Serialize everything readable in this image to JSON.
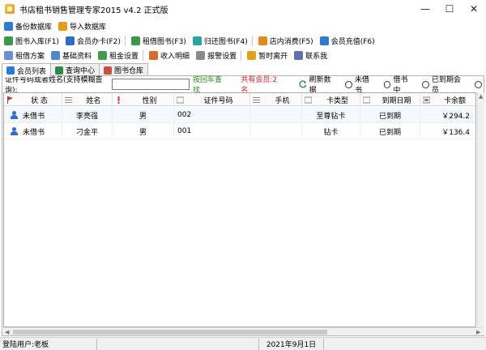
{
  "window": {
    "title": "书店租书销售管理专家2015 v4.2 正式版",
    "controls": {
      "minimize": "—",
      "maximize": "☐",
      "close": "✕"
    }
  },
  "toolbar1": [
    {
      "label": "备份数据库",
      "icon": "database-backup-icon",
      "color": "#2b7bd8"
    },
    {
      "label": "导入数据库",
      "icon": "database-import-icon",
      "color": "#e59b22"
    }
  ],
  "toolbar2": [
    {
      "label": "图书入库(F1)",
      "icon": "book-stock-icon",
      "color": "#3a9a4a"
    },
    {
      "label": "会员办卡(F2)",
      "icon": "member-card-icon",
      "color": "#2b6fc9"
    },
    {
      "label": "租借图书(F3)",
      "icon": "book-lend-icon",
      "color": "#3a9a4a"
    },
    {
      "label": "归还图书(F4)",
      "icon": "book-return-icon",
      "color": "#2aa6a0"
    },
    {
      "label": "店内消费(F5)",
      "icon": "in-store-consume-icon",
      "color": "#e28a1e"
    },
    {
      "label": "会员充值(F6)",
      "icon": "member-recharge-icon",
      "color": "#2b7bd8"
    }
  ],
  "toolbar3": [
    {
      "label": "租借方案",
      "icon": "rental-plan-icon",
      "color": "#6b8fd6"
    },
    {
      "label": "基础资料",
      "icon": "basic-data-icon",
      "color": "#4f86d0"
    },
    {
      "label": "租金设置",
      "icon": "rent-setting-icon",
      "color": "#3d9e52"
    },
    {
      "label": "收入明细",
      "icon": "income-detail-icon",
      "color": "#d56b2c"
    },
    {
      "label": "报警设置",
      "icon": "alarm-setting-icon",
      "color": "#8a8a8a"
    },
    {
      "label": "暂时离开",
      "icon": "lock-icon",
      "color": "#e0a21c"
    },
    {
      "label": "联系我",
      "icon": "contact-icon",
      "color": "#5f6fb0"
    }
  ],
  "tabs": [
    {
      "label": "会员列表",
      "active": true,
      "icon": "member-list-icon",
      "color": "#2b7bd8"
    },
    {
      "label": "查询中心",
      "active": false,
      "icon": "query-center-icon",
      "color": "#2e8a4a"
    },
    {
      "label": "图书仓库",
      "active": false,
      "icon": "book-warehouse-icon",
      "color": "#c74f3b"
    }
  ],
  "search": {
    "label": "证件号码或者姓名(支持模糊查询):",
    "value": "",
    "hint": "按回车查找",
    "member_count": "共有会员:2名",
    "refresh": "刷新数据",
    "filters": [
      "未借书",
      "借书中",
      "已到期会员"
    ]
  },
  "table": {
    "headers": [
      "状 态",
      "姓名",
      "性别",
      "证件号码",
      "手机",
      "卡类型",
      "到期日期",
      "卡余额"
    ],
    "rows": [
      {
        "status": "未借书",
        "name": "李亮强",
        "gender": "男",
        "id": "002",
        "phone": "",
        "card_type": "至尊钻卡",
        "expiry": "已到期",
        "balance": "￥294.2"
      },
      {
        "status": "未借书",
        "name": "刁金平",
        "gender": "男",
        "id": "001",
        "phone": "",
        "card_type": "钻卡",
        "expiry": "已到期",
        "balance": "￥136.4"
      }
    ]
  },
  "status_bar": {
    "user": "登陆用户:老板",
    "date": "2021年9月1日"
  }
}
